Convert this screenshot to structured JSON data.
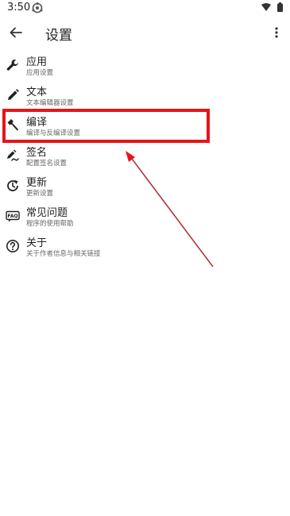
{
  "status_bar": {
    "time": "3:50",
    "app_icon": "android-app-icon",
    "wifi_icon": "wifi-icon",
    "battery_icon": "battery-icon"
  },
  "app_bar": {
    "back_icon": "arrow-back-icon",
    "title": "设置",
    "menu_icon": "more-vert-icon"
  },
  "settings": [
    {
      "id": "app",
      "icon": "wrench-icon",
      "label": "应用",
      "sub": "应用设置"
    },
    {
      "id": "text",
      "icon": "pencil-icon",
      "label": "文本",
      "sub": "文本编辑器设置"
    },
    {
      "id": "compile",
      "icon": "hammer-icon",
      "label": "编译",
      "sub": "编译与反编译设置"
    },
    {
      "id": "sign",
      "icon": "signature-icon",
      "label": "签名",
      "sub": "配置签名设置"
    },
    {
      "id": "update",
      "icon": "update-icon",
      "label": "更新",
      "sub": "更新设置"
    },
    {
      "id": "faq",
      "icon": "faq-icon",
      "label": "常见问题",
      "sub": "程序的使用帮助"
    },
    {
      "id": "about",
      "icon": "help-circle-icon",
      "label": "关于",
      "sub": "关于作者信息与相关链接"
    }
  ],
  "annotation": {
    "highlighted_item": "compile",
    "color": "#e8131a"
  }
}
